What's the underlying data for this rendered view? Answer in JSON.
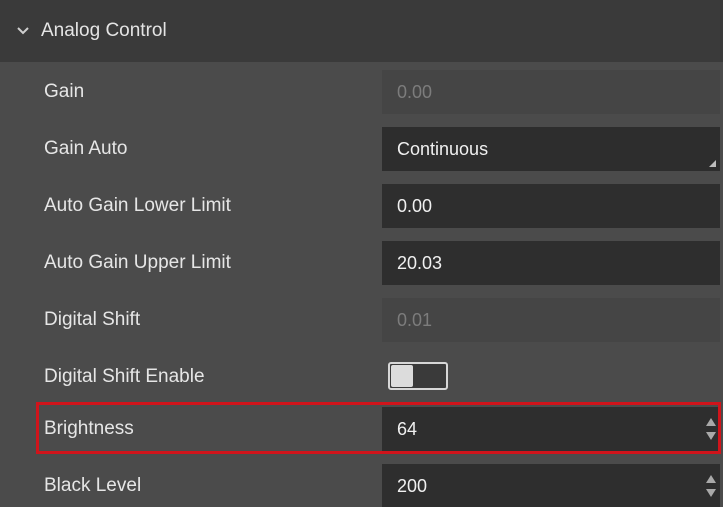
{
  "section": {
    "title": "Analog Control",
    "expanded": true
  },
  "properties": [
    {
      "label": "Gain",
      "value": "0.00",
      "state": "disabled"
    },
    {
      "label": "Gain Auto",
      "value": "Continuous",
      "state": "combo"
    },
    {
      "label": "Auto Gain Lower Limit",
      "value": "0.00",
      "state": "editable"
    },
    {
      "label": "Auto Gain Upper Limit",
      "value": "20.03",
      "state": "editable"
    },
    {
      "label": "Digital Shift",
      "value": "0.01",
      "state": "disabled"
    },
    {
      "label": "Digital Shift Enable",
      "toggle_on": false,
      "state": "toggle"
    },
    {
      "label": "Brightness",
      "value": "64",
      "state": "spin",
      "highlighted": true
    },
    {
      "label": "Black Level",
      "value": "200",
      "state": "spin"
    }
  ],
  "colors": {
    "highlight_border": "#d0141b",
    "panel_bg": "#4b4b4b",
    "header_bg": "#3a3a3a",
    "field_bg": "#2e2e2e",
    "disabled_text": "#7c7c7c"
  }
}
